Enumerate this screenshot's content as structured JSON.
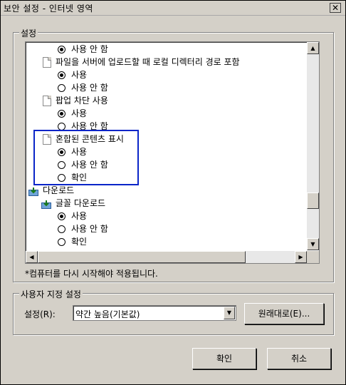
{
  "window": {
    "title": "보안 설정 - 인터넷 영역",
    "close_glyph": "✕"
  },
  "settings_group": {
    "label": "설정"
  },
  "list": {
    "items": [
      {
        "kind": "radio",
        "checked": true,
        "label": "사용 안 함"
      },
      {
        "kind": "page",
        "label": "파일을 서버에 업로드할 때 로컬 디렉터리 경로 포함"
      },
      {
        "kind": "radio",
        "checked": true,
        "label": "사용"
      },
      {
        "kind": "radio",
        "checked": false,
        "label": "사용 안 함"
      },
      {
        "kind": "page",
        "label": "팝업 차단 사용"
      },
      {
        "kind": "radio",
        "checked": true,
        "label": "사용"
      },
      {
        "kind": "radio",
        "checked": false,
        "label": "사용 안 함"
      },
      {
        "kind": "page",
        "label": "혼합된 콘텐츠 표시"
      },
      {
        "kind": "radio",
        "checked": true,
        "label": "사용"
      },
      {
        "kind": "radio",
        "checked": false,
        "label": "사용 안 함"
      },
      {
        "kind": "radio",
        "checked": false,
        "label": "확인"
      },
      {
        "kind": "download-folder",
        "label": "다운로드"
      },
      {
        "kind": "download-item",
        "label": "글꼴 다운로드"
      },
      {
        "kind": "radio",
        "checked": true,
        "label": "사용"
      },
      {
        "kind": "radio",
        "checked": false,
        "label": "사용 안 함"
      },
      {
        "kind": "radio",
        "checked": false,
        "label": "확인"
      }
    ],
    "scroll_up_glyph": "▲",
    "scroll_down_glyph": "▼",
    "scroll_left_glyph": "◀",
    "scroll_right_glyph": "▶"
  },
  "note": "*컴퓨터를 다시 시작해야 적용됩니다.",
  "custom_group": {
    "label": "사용자 지정 설정",
    "dropdown_label": "설정(R):",
    "dropdown_value": "약간 높음(기본값)",
    "dropdown_arrow": "▼",
    "reset_button": "원래대로(E)..."
  },
  "footer": {
    "ok": "확인",
    "cancel": "취소"
  },
  "colors": {
    "highlight_box": "#0a25c8",
    "dialog_bg": "#d4d0c8"
  }
}
